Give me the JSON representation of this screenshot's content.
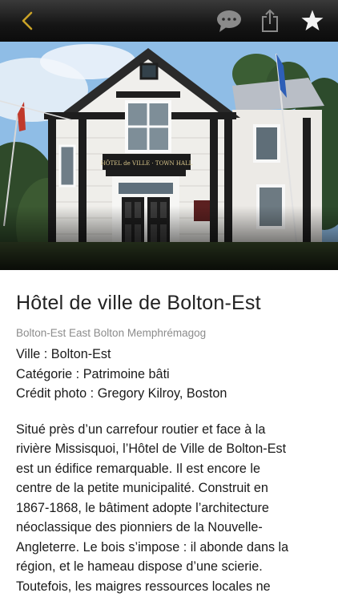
{
  "nav": {
    "back_icon": "chevron-left-icon",
    "comment_icon": "speech-bubble-icon",
    "share_icon": "share-icon",
    "favorite_icon": "star-icon",
    "accent_color": "#c9a227"
  },
  "place": {
    "title": "Hôtel de ville de Bolton-Est",
    "tags": "Bolton-Est East Bolton Memphrémagog",
    "sign_text": "HÔTEL de VILLE · TOWN HALL",
    "ville_label": "Ville :",
    "ville_value": "Bolton-Est",
    "categorie_label": "Catégorie :",
    "categorie_value": "Patrimoine bâti",
    "credit_label": "Crédit photo :",
    "credit_value": "Gregory Kilroy, Boston",
    "description_lines": [
      "Situé près d’un carrefour routier et face à la",
      "rivière Missisquoi, l’Hôtel de Ville de Bolton-Est",
      "est un édifice remarquable. Il est encore le",
      "centre de la petite municipalité. Construit en",
      "1867-1868, le bâtiment adopte l’architecture",
      "néoclassique des pionniers de la Nouvelle-",
      "Angleterre.  Le bois s’impose : il abonde dans la",
      "région, et le hameau dispose d’une scierie.",
      "Toutefois, les maigres ressources locales ne"
    ]
  }
}
